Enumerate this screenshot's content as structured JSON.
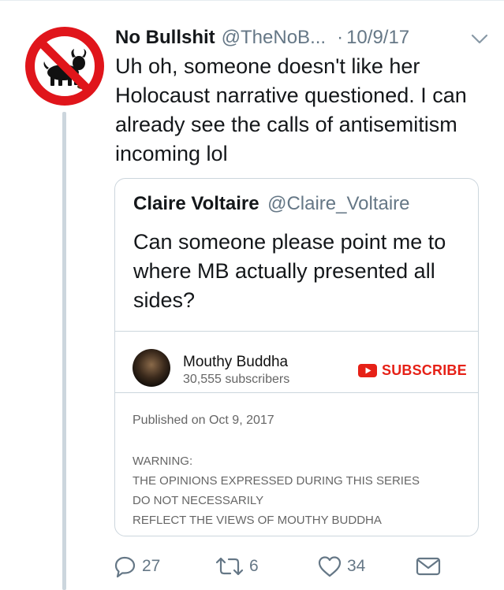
{
  "tweet": {
    "display_name": "No Bullshit",
    "handle": "@TheNoB...",
    "separator": "·",
    "date": "10/9/17",
    "text": "Uh oh, someone doesn't like her Holocaust narrative questioned. I can already see the calls of antisemitism incoming lol",
    "avatar_icon": "no-bullshit-logo-icon",
    "brand_red": "#e0151b"
  },
  "quote": {
    "display_name": "Claire Voltaire",
    "handle": "@Claire_Voltaire",
    "text": "Can someone please point me to where MB actually presented all sides?",
    "youtube": {
      "channel_name": "Mouthy Buddha",
      "subscribers": "30,555 subscribers",
      "subscribe_label": "SUBSCRIBE",
      "published": "Published on Oct 9, 2017",
      "description_lines": [
        "WARNING:",
        "THE OPINIONS EXPRESSED DURING THIS SERIES",
        "DO NOT NECESSARILY",
        "REFLECT THE VIEWS OF MOUTHY BUDDHA"
      ],
      "accent": "#e62117"
    }
  },
  "actions": {
    "reply_count": "27",
    "retweet_count": "6",
    "like_count": "34",
    "icon_color": "#657786"
  }
}
